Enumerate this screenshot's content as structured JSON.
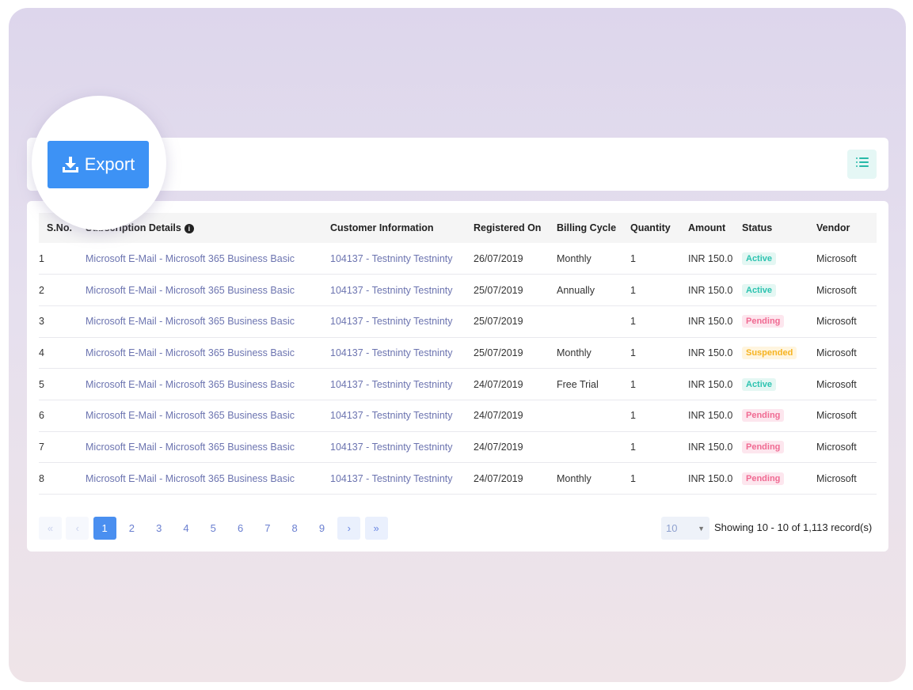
{
  "toolbar": {
    "export_label": "Export"
  },
  "table": {
    "headers": [
      "S.No.",
      "Subscription Details",
      "Customer Information",
      "Registered On",
      "Billing Cycle",
      "Quantity",
      "Amount",
      "Status",
      "Vendor"
    ],
    "rows": [
      {
        "sno": "1",
        "subscription": "Microsoft E-Mail - Microsoft 365 Business Basic",
        "customer": "104137 - Testninty Testninty",
        "registered": "26/07/2019",
        "billing": "Monthly",
        "quantity": "1",
        "amount": "INR 150.0",
        "status": "Active",
        "vendor": "Microsoft"
      },
      {
        "sno": "2",
        "subscription": "Microsoft E-Mail - Microsoft 365 Business Basic",
        "customer": "104137 - Testninty Testninty",
        "registered": "25/07/2019",
        "billing": "Annually",
        "quantity": "1",
        "amount": "INR 150.0",
        "status": "Active",
        "vendor": "Microsoft"
      },
      {
        "sno": "3",
        "subscription": "Microsoft E-Mail - Microsoft 365 Business Basic",
        "customer": "104137 - Testninty Testninty",
        "registered": "25/07/2019",
        "billing": "",
        "quantity": "1",
        "amount": "INR 150.0",
        "status": "Pending",
        "vendor": "Microsoft"
      },
      {
        "sno": "4",
        "subscription": "Microsoft E-Mail - Microsoft 365 Business Basic",
        "customer": "104137 - Testninty Testninty",
        "registered": "25/07/2019",
        "billing": "Monthly",
        "quantity": "1",
        "amount": "INR 150.0",
        "status": "Suspended",
        "vendor": "Microsoft"
      },
      {
        "sno": "5",
        "subscription": "Microsoft E-Mail - Microsoft 365 Business Basic",
        "customer": "104137 - Testninty Testninty",
        "registered": "24/07/2019",
        "billing": "Free Trial",
        "quantity": "1",
        "amount": "INR 150.0",
        "status": "Active",
        "vendor": "Microsoft"
      },
      {
        "sno": "6",
        "subscription": "Microsoft E-Mail - Microsoft 365 Business Basic",
        "customer": "104137 - Testninty Testninty",
        "registered": "24/07/2019",
        "billing": "",
        "quantity": "1",
        "amount": "INR 150.0",
        "status": "Pending",
        "vendor": "Microsoft"
      },
      {
        "sno": "7",
        "subscription": "Microsoft E-Mail - Microsoft 365 Business Basic",
        "customer": "104137 - Testninty Testninty",
        "registered": "24/07/2019",
        "billing": "",
        "quantity": "1",
        "amount": "INR 150.0",
        "status": "Pending",
        "vendor": "Microsoft"
      },
      {
        "sno": "8",
        "subscription": "Microsoft E-Mail - Microsoft 365 Business Basic",
        "customer": "104137 - Testninty Testninty",
        "registered": "24/07/2019",
        "billing": "Monthly",
        "quantity": "1",
        "amount": "INR 150.0",
        "status": "Pending",
        "vendor": "Microsoft"
      }
    ]
  },
  "status_colors": {
    "Active": "#2cc3b0",
    "Pending": "#f06a92",
    "Suspended": "#f6b320"
  },
  "pagination": {
    "first_icon": "double-chevron-left-icon",
    "prev_icon": "chevron-left-icon",
    "pages": [
      "1",
      "2",
      "3",
      "4",
      "5",
      "6",
      "7",
      "8",
      "9"
    ],
    "current_page": "1",
    "next_icon": "chevron-right-icon",
    "last_icon": "double-chevron-right-icon",
    "per_page": "10",
    "showing_text": "Showing 10 - 10 of 1,113 record(s)"
  },
  "icons": {
    "export": "download-icon",
    "list_toggle": "list-icon",
    "info": "info-icon"
  },
  "accent_color": "#3d92f5"
}
